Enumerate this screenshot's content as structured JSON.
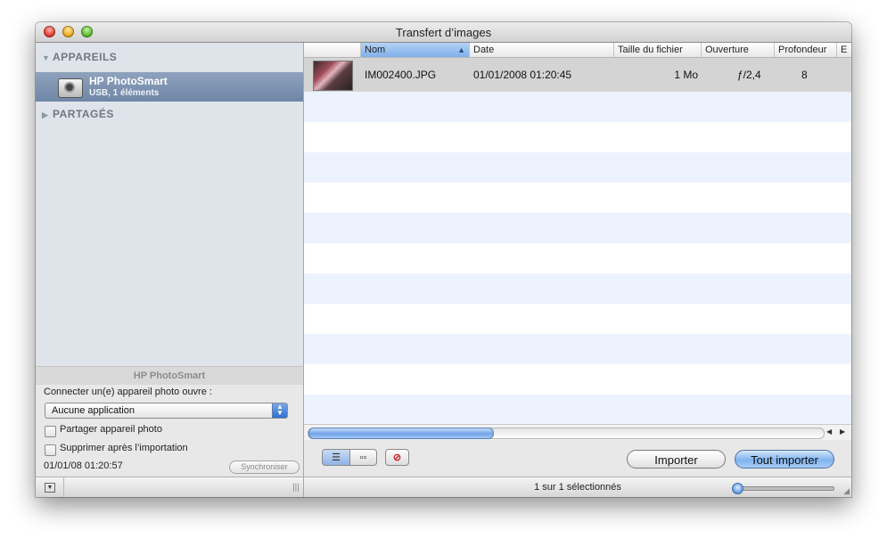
{
  "window": {
    "title": "Transfert d’images"
  },
  "sidebar": {
    "devices_header": "APPAREILS",
    "device": {
      "name": "HP PhotoSmart",
      "subtitle": "USB, 1 éléments"
    },
    "shared_header": "PARTAGÉS",
    "triangle_open": "▼",
    "triangle_closed": "▶"
  },
  "device_panel": {
    "title": "HP PhotoSmart",
    "connect_label": "Connecter un(e) appareil photo ouvre :",
    "app_select_value": "Aucune application",
    "share_checkbox_label": "Partager appareil photo",
    "delete_checkbox_label": "Supprimer après l’importation",
    "share_checked": false,
    "delete_checked": false,
    "datetime": "01/01/08 01:20:57",
    "sync_button": "Synchroniser"
  },
  "table": {
    "columns": [
      "Nom",
      "Date",
      "Taille du fichier",
      "Ouverture",
      "Profondeur",
      "E"
    ],
    "sorted_column": "Nom",
    "rows": [
      {
        "name": "IM002400.JPG",
        "date": "01/01/2008 01:20:45",
        "size": "1 Mo",
        "aperture": "ƒ/2,4",
        "depth": "8"
      }
    ]
  },
  "toolbar": {
    "import_button": "Importer",
    "import_all_button": "Tout importer"
  },
  "status": {
    "text": "1 sur 1 sélectionnés",
    "zoom_level": 0.0
  },
  "icons": {
    "list_view": "list-view-icon",
    "grid_view": "grid-view-icon",
    "delete": "delete-icon",
    "camera": "camera-icon"
  }
}
